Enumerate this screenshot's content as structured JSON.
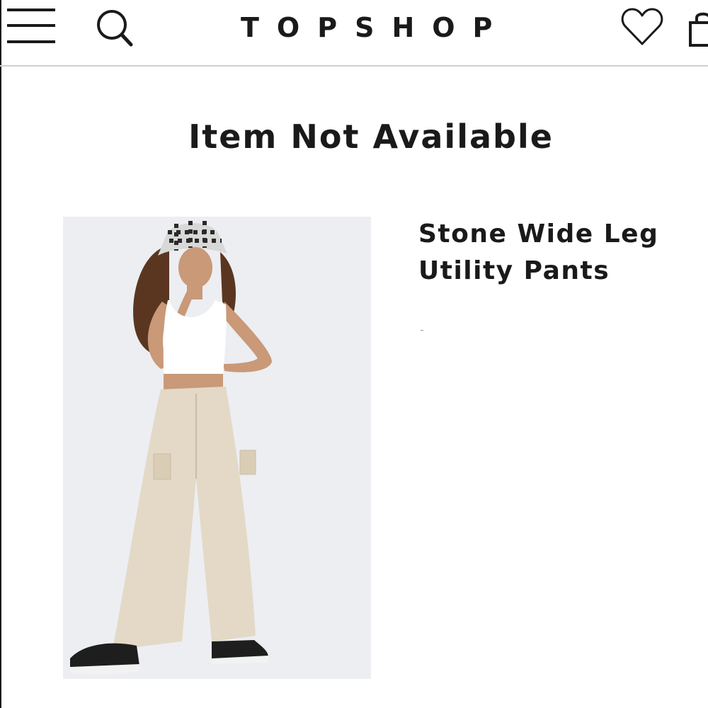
{
  "header": {
    "logo": "TOPSHOP",
    "menu_icon": "hamburger-menu-icon",
    "search_icon": "search-icon",
    "wishlist_icon": "heart-icon",
    "bag_icon": "shopping-bag-icon"
  },
  "page": {
    "title": "Item Not Available"
  },
  "product": {
    "name": "Stone Wide Leg\nUtility Pants",
    "image_icon": "product-photo"
  },
  "colors": {
    "text": "#1a1a1a",
    "divider": "#cfcfcf",
    "image_bg": "#eceef2",
    "pants": "#e3d9c6"
  }
}
